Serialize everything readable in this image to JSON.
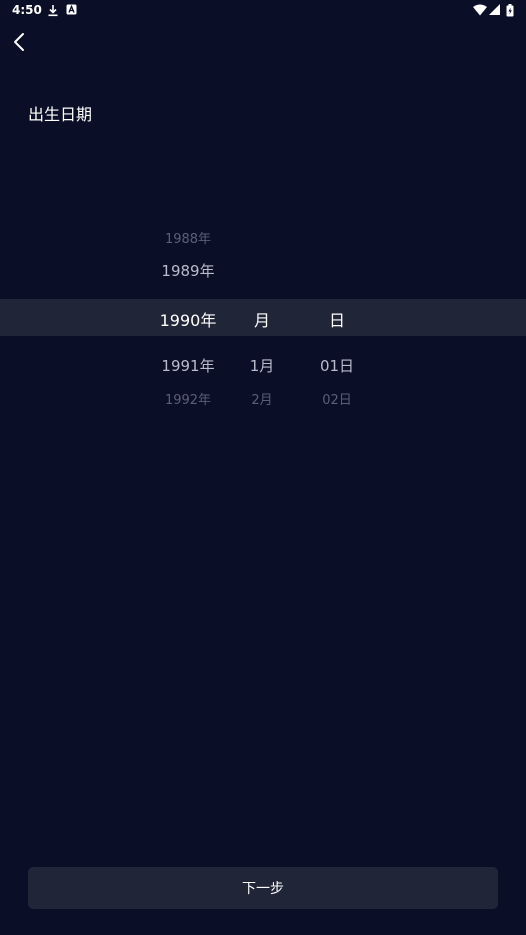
{
  "status_bar": {
    "time": "4:50",
    "icons": [
      "download-icon",
      "app-notification-icon",
      "wifi-icon",
      "signal-icon",
      "battery-icon"
    ]
  },
  "header": {
    "back_icon": "chevron-left-icon",
    "title": "出生日期"
  },
  "picker": {
    "year": {
      "items": [
        "1988年",
        "1989年",
        "1990年",
        "1991年",
        "1992年"
      ],
      "selected_index": 2
    },
    "month": {
      "selected": "月",
      "items": [
        "1月",
        "2月"
      ]
    },
    "day": {
      "selected": "日",
      "items": [
        "01日",
        "02日"
      ]
    }
  },
  "footer": {
    "next_label": "下一步"
  },
  "colors": {
    "background": "#0a0e26",
    "surface": "#212538",
    "text_primary": "#ffffff",
    "text_secondary": "#b9bccb",
    "text_dim": "#5a5f78"
  }
}
